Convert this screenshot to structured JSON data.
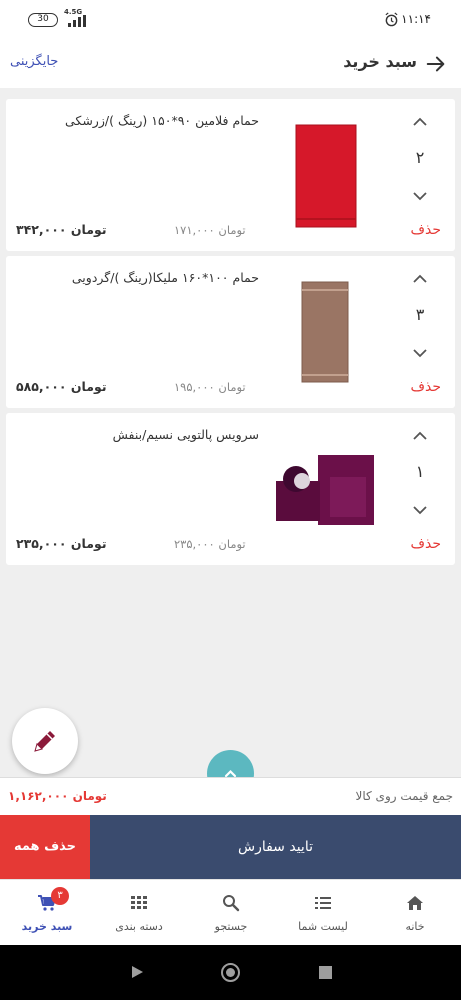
{
  "status_bar": {
    "battery": "30",
    "network": "4.5G",
    "time": "۱۱:۱۴"
  },
  "header": {
    "title": "سبد خرید",
    "alt_link": "جایگزینی"
  },
  "cart_items": [
    {
      "name": "حمام فلامین ۹۰*۱۵۰ (رینگ )/زرشکی",
      "quantity": "۲",
      "unit_price": "۱۷۱,۰۰۰ تومان",
      "total_price": "۳۴۲,۰۰۰ تومان",
      "delete_label": "حذف",
      "image_color": "#d6182a"
    },
    {
      "name": "حمام ۱۰۰*۱۶۰ ملیکا(رینگ )/گردویی",
      "quantity": "۳",
      "unit_price": "۱۹۵,۰۰۰ تومان",
      "total_price": "۵۸۵,۰۰۰ تومان",
      "delete_label": "حذف",
      "image_color": "#9a7564"
    },
    {
      "name": "سرویس پالتویی نسیم/بنفش",
      "quantity": "۱",
      "unit_price": "۲۳۵,۰۰۰ تومان",
      "total_price": "۲۳۵,۰۰۰ تومان",
      "delete_label": "حذف",
      "image_color": "#6b1049"
    }
  ],
  "summary": {
    "label": "جمع قیمت روی کالا",
    "value": "۱,۱۶۲,۰۰۰ تومان"
  },
  "actions": {
    "confirm": "تایید سفارش",
    "delete_all": "حذف همه"
  },
  "bottom_nav": {
    "items": [
      {
        "label": "خانه",
        "icon": "home-icon"
      },
      {
        "label": "لیست شما",
        "icon": "list-icon"
      },
      {
        "label": "جستجو",
        "icon": "search-icon"
      },
      {
        "label": "دسته بندی",
        "icon": "grid-icon"
      },
      {
        "label": "سبد خرید",
        "icon": "cart-icon"
      }
    ],
    "cart_badge": "۳"
  },
  "colors": {
    "accent": "#3f51b5",
    "danger": "#e53935",
    "confirm_bg": "#3a4b6e",
    "fab_teal": "#5cb8c0"
  }
}
